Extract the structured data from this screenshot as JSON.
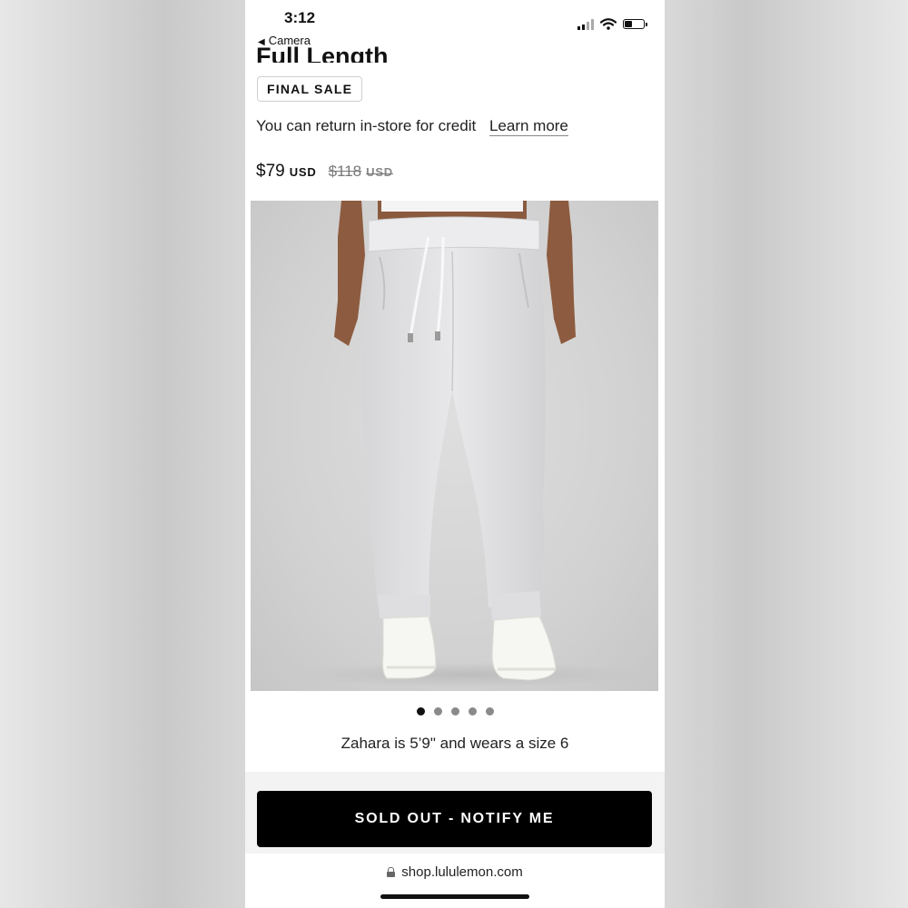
{
  "status_bar": {
    "time": "3:12",
    "back_label": "Camera",
    "back_icon": "back-triangle-icon",
    "icons": [
      "signal-icon",
      "wifi-icon",
      "battery-icon"
    ],
    "battery_level": 0.4
  },
  "product": {
    "title": "Full Length",
    "badge": "FINAL SALE",
    "return_text": "You can return in-store for credit",
    "learn_more_label": "Learn more",
    "price_current": "$79",
    "price_current_currency": "USD",
    "price_original": "$118",
    "price_original_currency": "USD"
  },
  "carousel": {
    "total": 5,
    "active_index": 0
  },
  "model_caption": "Zahara is 5’9\" and wears a size 6",
  "cta": {
    "label": "SOLD OUT - NOTIFY ME"
  },
  "browser": {
    "url": "shop.lululemon.com",
    "lock_icon": "lock-icon"
  },
  "colors": {
    "button_bg": "#000000",
    "button_text": "#ffffff",
    "accent_text": "#111111"
  }
}
